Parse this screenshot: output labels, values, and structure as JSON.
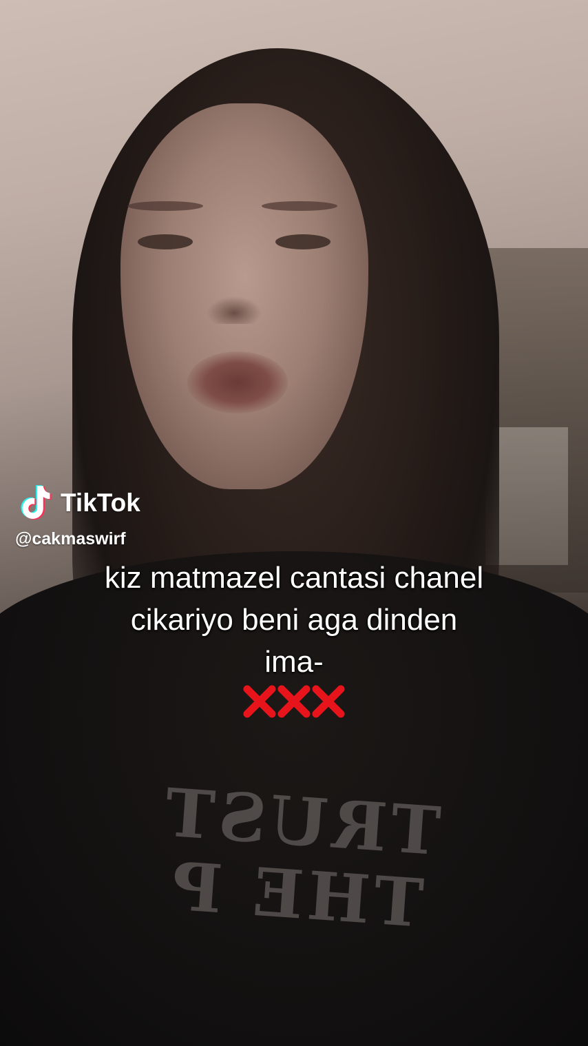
{
  "watermark": {
    "brand": "TikTok",
    "handle": "@cakmaswirf",
    "logo_icon": "tiktok-note-icon"
  },
  "caption": {
    "lines": [
      "kiz matmazel cantasi chanel",
      "cikariyo beni aga dinden",
      "ima-"
    ],
    "emoji_icons": [
      "cross-mark-icon",
      "cross-mark-icon",
      "cross-mark-icon"
    ],
    "emoji_color": "#e8141c"
  },
  "shirt_print": "TRUST THE P"
}
